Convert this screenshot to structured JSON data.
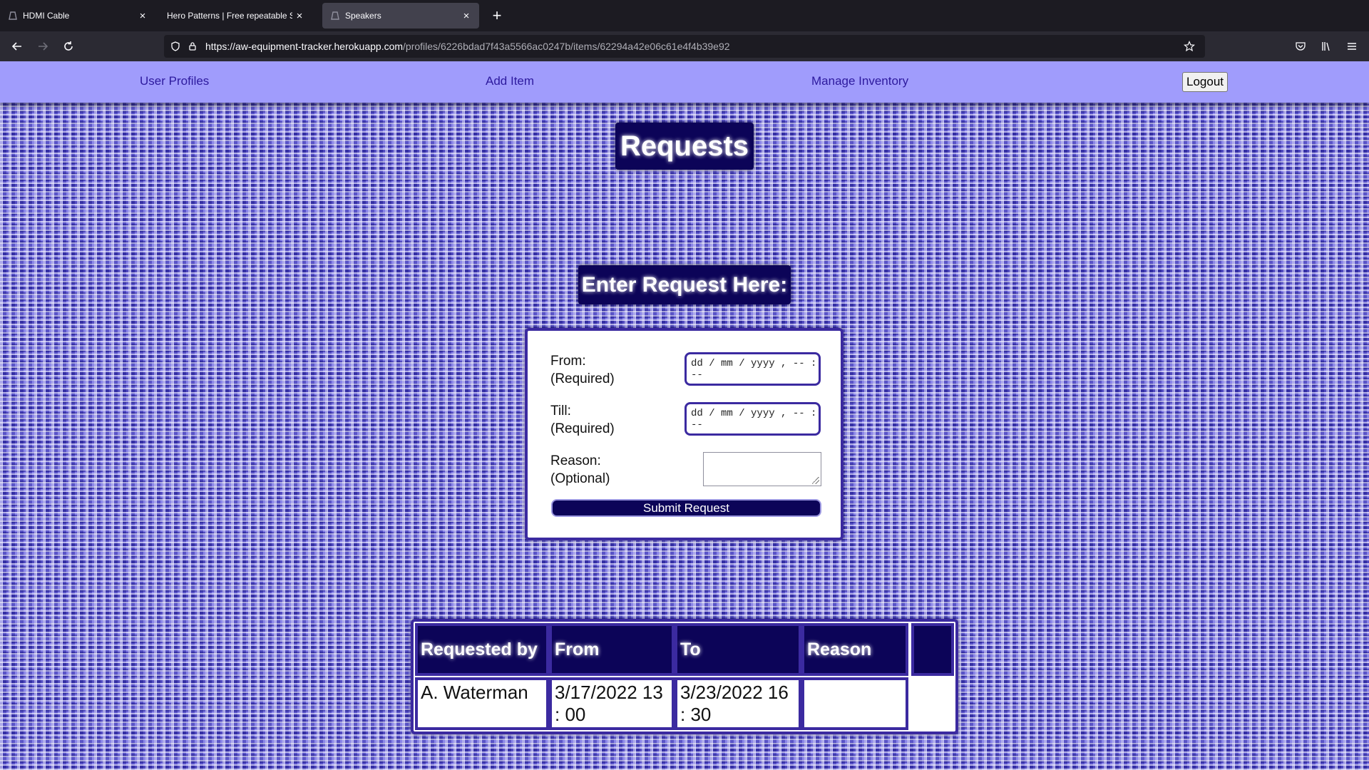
{
  "browser": {
    "tabs": [
      {
        "title": "HDMI Cable",
        "active": false
      },
      {
        "title": "Hero Patterns | Free repeatable SVG",
        "active": false
      },
      {
        "title": "Speakers",
        "active": true
      }
    ],
    "url_host": "https://aw-equipment-tracker.herokuapp.com",
    "url_path": "/profiles/6226bdad7f43a5566ac0247b/items/62294a42e06c61e4f4b39e92"
  },
  "site_nav": {
    "user_profiles": "User Profiles",
    "add_item": "Add Item",
    "manage_inventory": "Manage Inventory",
    "logout": "Logout"
  },
  "page": {
    "title": "Requests",
    "form_heading": "Enter Request Here:"
  },
  "form": {
    "from_label": "From:",
    "from_note": "(Required)",
    "from_placeholder": "dd / mm / yyyy ,  -- : --",
    "till_label": "Till:",
    "till_note": "(Required)",
    "till_placeholder": "dd / mm / yyyy ,  -- : --",
    "reason_label": "Reason:",
    "reason_note": "(Optional)",
    "reason_value": "",
    "submit_label": "Submit Request"
  },
  "table": {
    "headers": [
      "Requested by",
      "From",
      "To",
      "Reason",
      ""
    ],
    "rows": [
      {
        "requested_by": "A. Waterman",
        "from": "3/17/2022 13 : 00",
        "to": "3/23/2022 16 : 30",
        "reason": ""
      }
    ]
  },
  "colors": {
    "header_bar": "#a09cfc",
    "accent_navy": "#0c0458",
    "border_purple": "#3b2aa0",
    "link": "#2d1a9e"
  }
}
